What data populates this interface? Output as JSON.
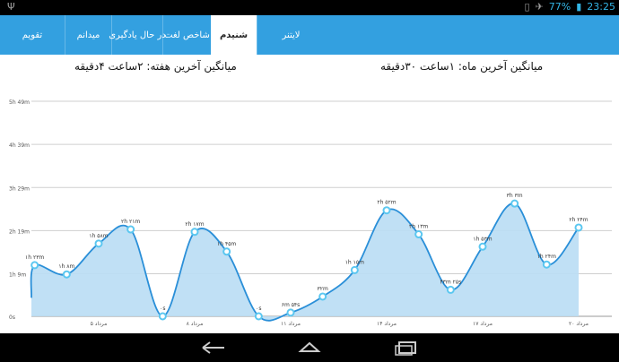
{
  "status_bar": {
    "left_icon": "usb-icon",
    "vibrate_icon": "vibrate-icon",
    "airplane_icon": "airplane-icon",
    "battery_percent": "77%",
    "battery_icon": "battery-icon",
    "time": "23:25"
  },
  "tabs": [
    {
      "label": "لایتنر",
      "active": false
    },
    {
      "label": "شنیدم",
      "active": true
    },
    {
      "label": "شاخص لغت",
      "active": false
    },
    {
      "label": "در حال یادگیری",
      "active": false
    },
    {
      "label": "میدانم",
      "active": false
    },
    {
      "label": "تقویم",
      "active": false
    }
  ],
  "headings": {
    "month": "میانگین آخرین ماه: ۱ساعت ۳۰دقیقه",
    "week": "میانگین آخرین هفته: ۲ساعت ۴دقیقه"
  },
  "chart_data": {
    "type": "area",
    "y_tick_labels": [
      "0s",
      "1h 9m",
      "2h 19m",
      "3h 29m",
      "4h 39m",
      "5h 49m"
    ],
    "y_ticks_minutes": [
      0,
      69,
      139,
      209,
      279,
      349
    ],
    "grid": true,
    "fill_color": "#b9ddf4",
    "line_color": "#2a8fd8",
    "x_tick_labels": [
      "۵ مرداد",
      "۸ مرداد",
      "۱۱ مرداد",
      "۱۴ مرداد",
      "۱۷ مرداد",
      "۲۰ مرداد"
    ],
    "x_tick_days": [
      5,
      8,
      11,
      14,
      17,
      20
    ],
    "x_range": [
      2,
      22
    ],
    "series": [
      {
        "points": [
          {
            "day": 3,
            "minutes": 83,
            "label": "۱h ۲۳m"
          },
          {
            "day": 4,
            "minutes": 68,
            "label": "۱h ۸m"
          },
          {
            "day": 5,
            "minutes": 118,
            "label": "۱h ۵۸m"
          },
          {
            "day": 6,
            "minutes": 141,
            "label": "۲h ۲۱m"
          },
          {
            "day": 7,
            "minutes": 0,
            "label": "۰s"
          },
          {
            "day": 8,
            "minutes": 137,
            "label": "۲h ۱۷m"
          },
          {
            "day": 9,
            "minutes": 105,
            "label": "۱h ۴۵m"
          },
          {
            "day": 10,
            "minutes": 0,
            "label": "۰s"
          },
          {
            "day": 11,
            "minutes": 6,
            "label": "۶m ۵۴s"
          },
          {
            "day": 12,
            "minutes": 32,
            "label": "۳۲m"
          },
          {
            "day": 13,
            "minutes": 75,
            "label": "۱h ۱۵m"
          },
          {
            "day": 14,
            "minutes": 172,
            "label": "۲h ۵۲m"
          },
          {
            "day": 15,
            "minutes": 133,
            "label": "۲h ۱۳m"
          },
          {
            "day": 16,
            "minutes": 43,
            "label": "۴۳m ۲۵s"
          },
          {
            "day": 17,
            "minutes": 113,
            "label": "۱h ۵۳m"
          },
          {
            "day": 18,
            "minutes": 183,
            "label": "۳h ۳m"
          },
          {
            "day": 19,
            "minutes": 84,
            "label": "۱h ۲۴m"
          },
          {
            "day": 20,
            "minutes": 144,
            "label": "۲h ۲۴m"
          }
        ]
      }
    ]
  }
}
